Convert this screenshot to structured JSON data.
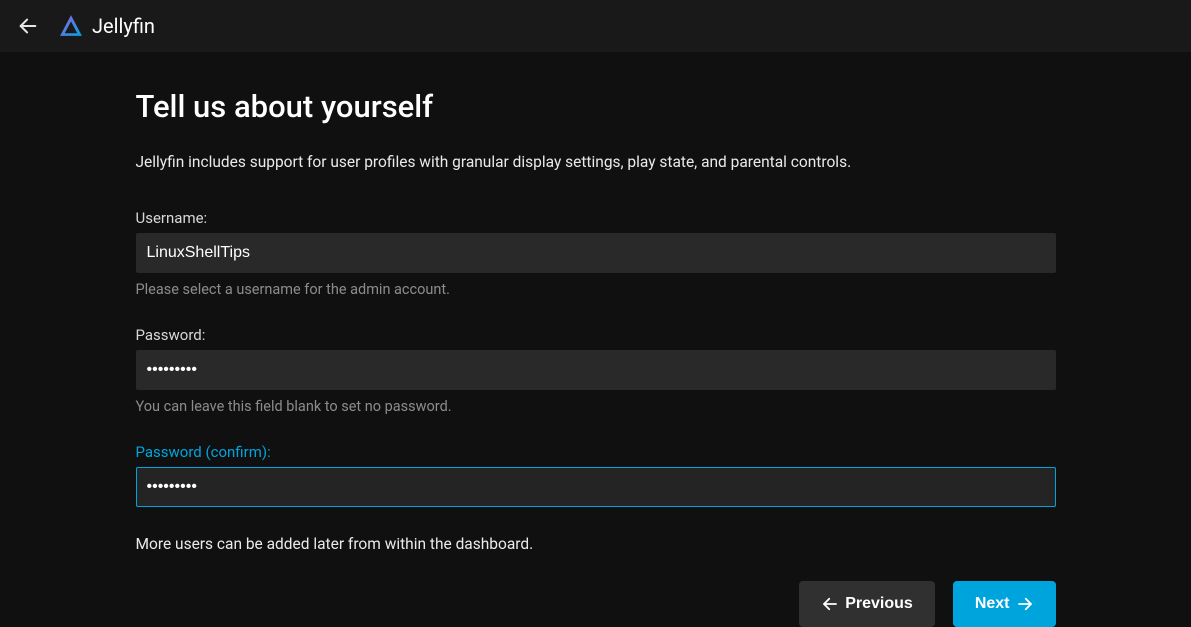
{
  "header": {
    "app_name": "Jellyfin"
  },
  "page": {
    "title": "Tell us about yourself",
    "intro": "Jellyfin includes support for user profiles with granular display settings, play state, and parental controls.",
    "footnote": "More users can be added later from within the dashboard."
  },
  "form": {
    "username": {
      "label": "Username:",
      "value": "LinuxShellTips",
      "help": "Please select a username for the admin account."
    },
    "password": {
      "label": "Password:",
      "value": "•••••••••",
      "help": "You can leave this field blank to set no password."
    },
    "password_confirm": {
      "label": "Password (confirm):",
      "value": "•••••••••"
    }
  },
  "buttons": {
    "previous": "Previous",
    "next": "Next"
  },
  "colors": {
    "accent": "#00a4dc",
    "bg": "#101010",
    "header_bg": "#191919",
    "input_bg": "#292929",
    "btn_prev_bg": "#303030"
  }
}
